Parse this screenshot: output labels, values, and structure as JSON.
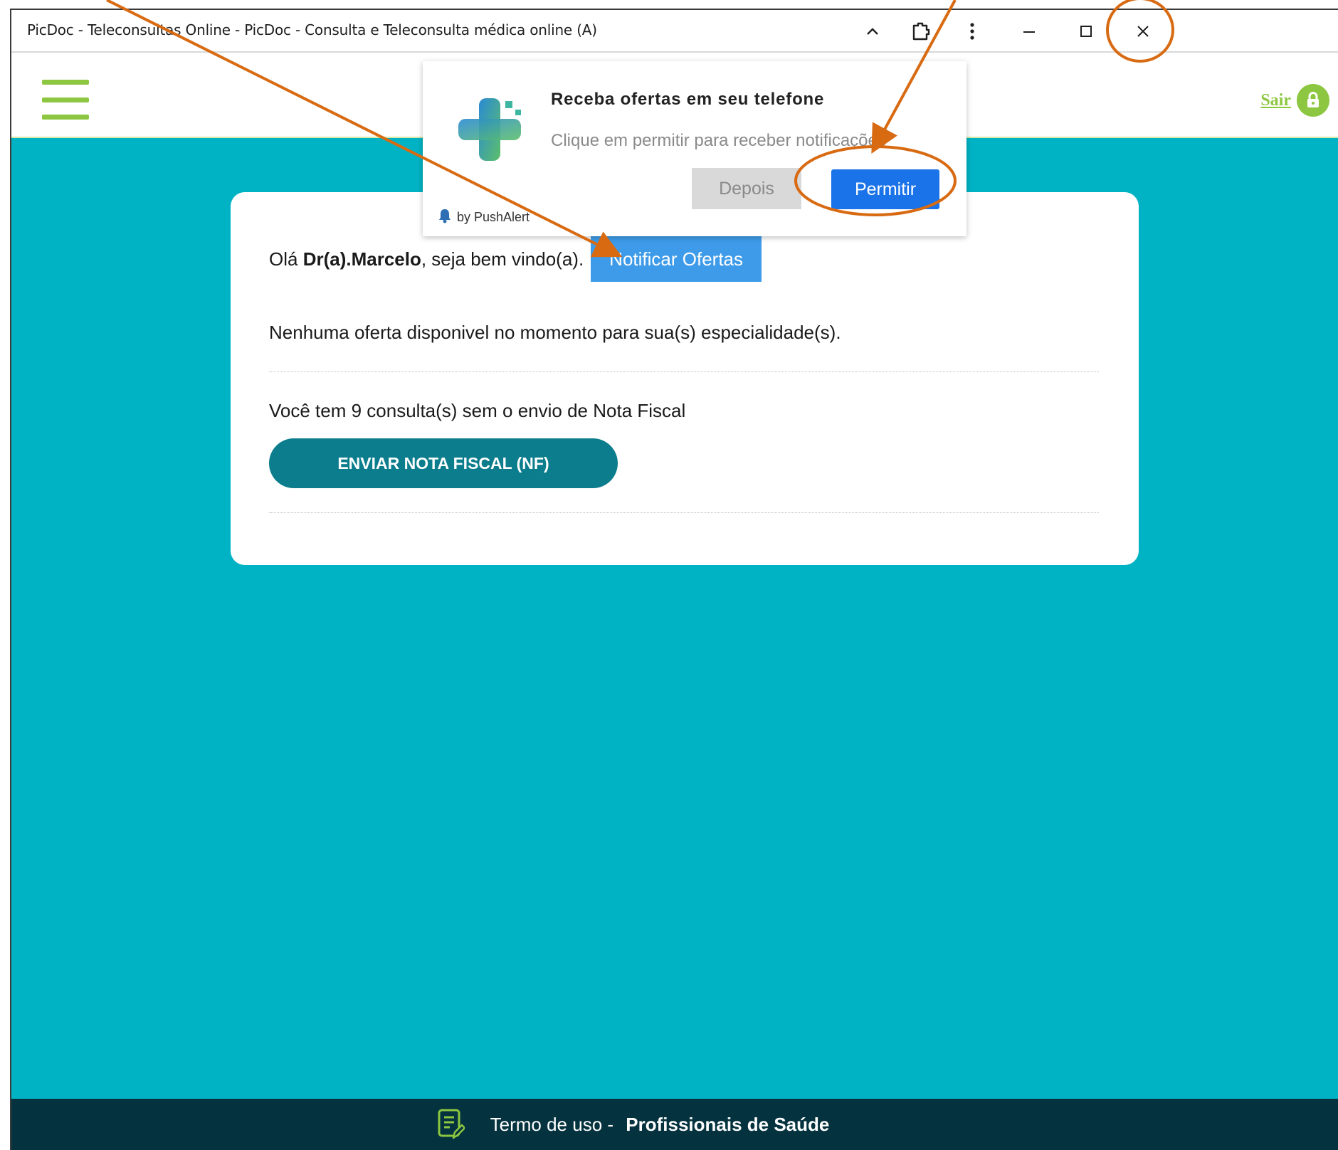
{
  "window": {
    "title": "PicDoc - Teleconsultas Online - PicDoc - Consulta e Teleconsulta médica online (A)",
    "controls": [
      "chevron-up-icon",
      "extension-icon",
      "more-vert-icon",
      "minimize-icon",
      "maximize-icon",
      "close-icon"
    ]
  },
  "header": {
    "logout_label": "Sair"
  },
  "popup": {
    "title": "Receba ofertas em seu telefone",
    "message": "Clique em permitir para receber notificações",
    "later_label": "Depois",
    "allow_label": "Permitir",
    "provider": "by PushAlert"
  },
  "card": {
    "greeting_prefix": "Olá ",
    "doctor_name": "Dr(a).Marcelo",
    "greeting_suffix": ", seja bem vindo(a).",
    "notify_label": "Notificar Ofertas",
    "no_offer_text": "Nenhuma oferta disponivel no momento para sua(s) especialidade(s).",
    "nf_text": "Você tem 9 consulta(s) sem o envio de Nota Fiscal",
    "nf_button_label": "ENVIAR NOTA FISCAL (NF)"
  },
  "footer": {
    "terms_prefix": "Termo de uso - ",
    "terms_bold": "Profissionais de Saúde"
  },
  "colors": {
    "brand_green": "#8dc641",
    "main_teal": "#00b3c4",
    "nf_button": "#0b7d8c",
    "footer_bg": "#04323e",
    "allow_blue": "#1a73e8",
    "annotation_orange": "#d86a12"
  }
}
